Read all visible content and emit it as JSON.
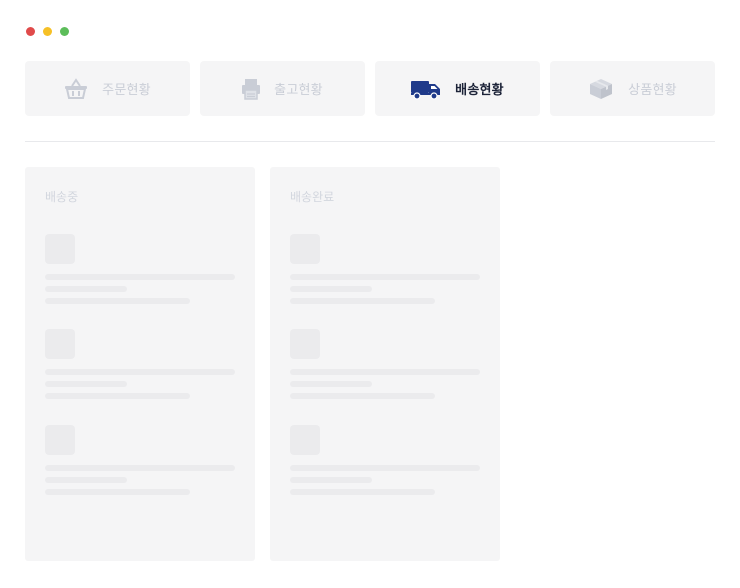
{
  "window": {
    "controls": [
      {
        "name": "close",
        "color": "#e04a4a"
      },
      {
        "name": "minimize",
        "color": "#f6c026"
      },
      {
        "name": "maximize",
        "color": "#5cbd5a"
      }
    ]
  },
  "tabs": [
    {
      "id": "orders",
      "label": "주문현황",
      "icon": "basket-icon",
      "active": false
    },
    {
      "id": "shipping-out",
      "label": "출고현황",
      "icon": "printer-icon",
      "active": false
    },
    {
      "id": "delivery",
      "label": "배송현황",
      "icon": "delivery-truck-icon",
      "active": true
    },
    {
      "id": "products",
      "label": "상품현황",
      "icon": "box-icon",
      "active": false
    }
  ],
  "colors": {
    "active_icon": "#1f3a8a",
    "inactive_icon": "#c9cdd6",
    "active_text": "#1c2338"
  },
  "board": {
    "columns": [
      {
        "title": "배송중",
        "placeholder_cards": 3
      },
      {
        "title": "배송완료",
        "placeholder_cards": 3
      }
    ]
  }
}
